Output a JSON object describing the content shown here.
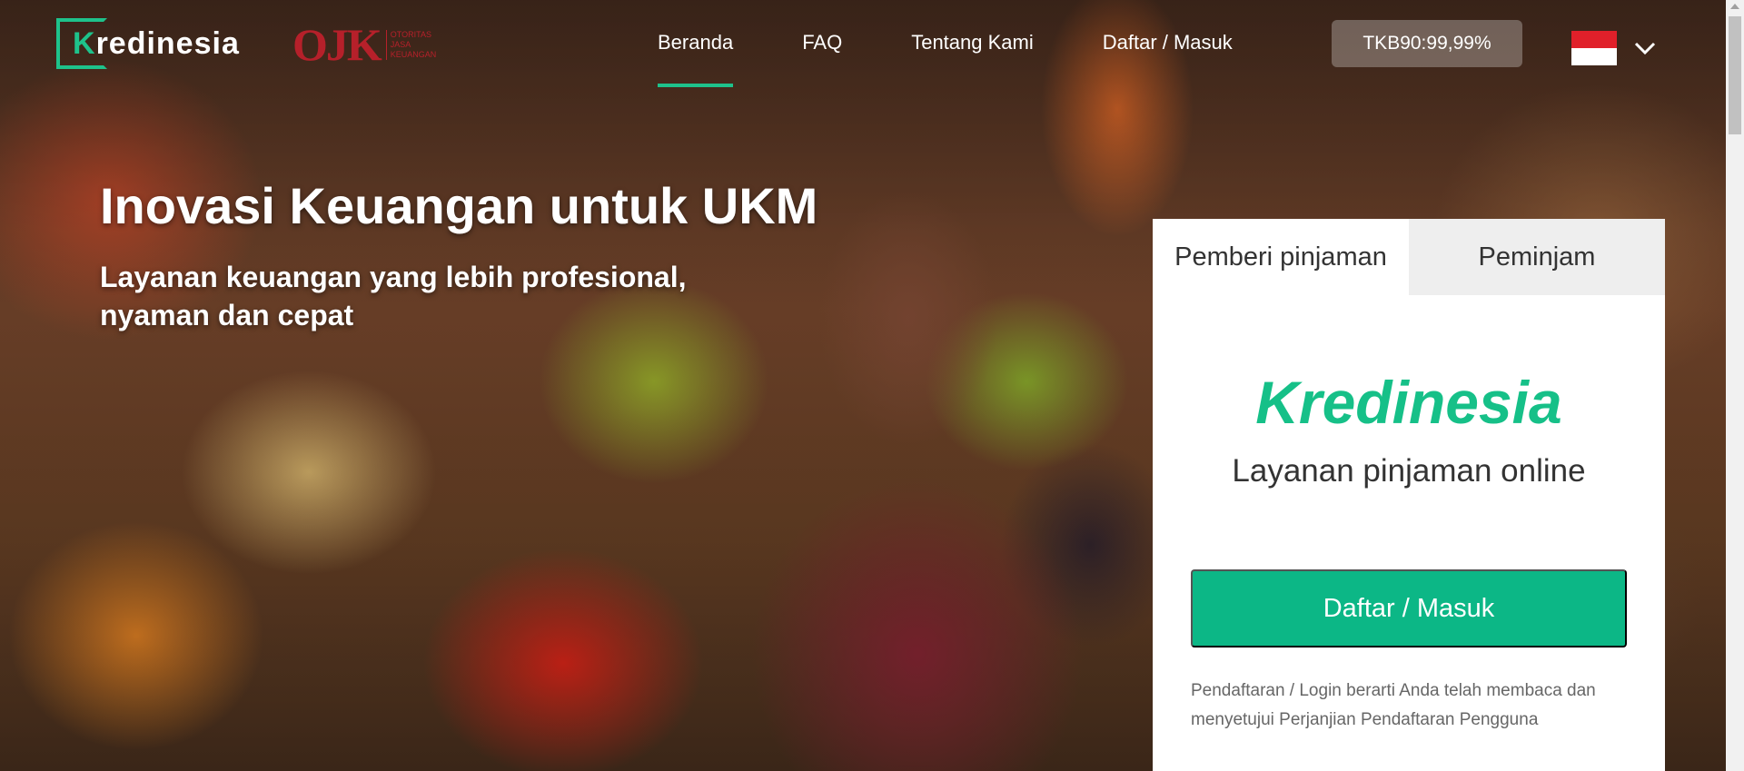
{
  "header": {
    "logo_text": "Kredinesia",
    "ojk_mark": "OJK",
    "ojk_sub": [
      "OTORITAS",
      "JASA",
      "KEUANGAN"
    ],
    "nav": [
      {
        "label": "Beranda",
        "active": true
      },
      {
        "label": "FAQ",
        "active": false
      },
      {
        "label": "Tentang Kami",
        "active": false
      },
      {
        "label": "Daftar / Masuk",
        "active": false
      }
    ],
    "tkb": "TKB90:99,99%",
    "language_flag": "indonesia-flag-icon"
  },
  "hero": {
    "title": "Inovasi Keuangan untuk UKM",
    "subtitle": "Layanan keuangan yang lebih profesional, nyaman dan cepat"
  },
  "panel": {
    "tabs": [
      {
        "label": "Pemberi pinjaman",
        "active": true
      },
      {
        "label": "Peminjam",
        "active": false
      }
    ],
    "brand": "Kredinesia",
    "tagline": "Layanan pinjaman online",
    "cta_label": "Daftar / Masuk",
    "terms": "Pendaftaran / Login berarti Anda telah membaca dan menyetujui Perjanjian Pendaftaran Pengguna"
  },
  "colors": {
    "accent": "#1ec28b",
    "button": "#0cb786",
    "ojk_red": "#b6202a"
  }
}
